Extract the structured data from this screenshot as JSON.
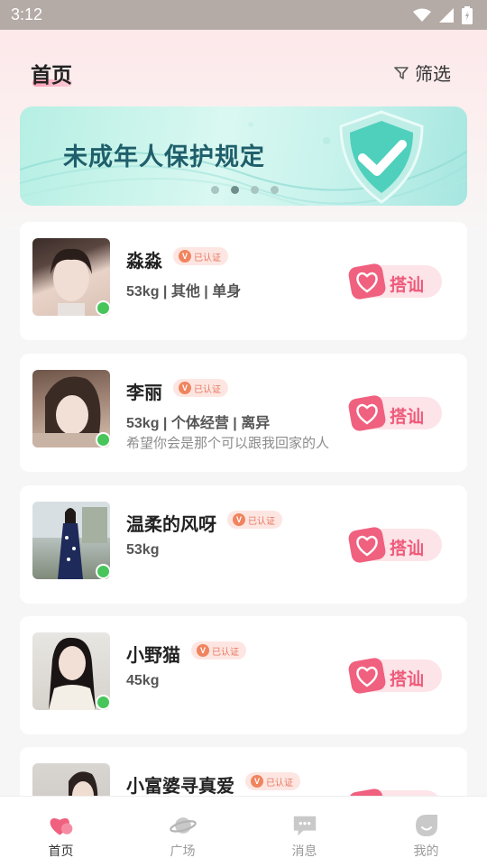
{
  "status_bar": {
    "time": "3:12"
  },
  "header": {
    "title": "首页",
    "filter_label": "筛选"
  },
  "banner": {
    "text": "未成年人保护规定",
    "active_dot": 2
  },
  "verified_label": "已认证",
  "chat_label": "搭讪",
  "users": [
    {
      "name": "淼淼",
      "info": "53kg | 其他 | 单身",
      "signature": "",
      "online": true
    },
    {
      "name": "李丽",
      "info": "53kg | 个体经营 | 离异",
      "signature": "希望你会是那个可以跟我回家的人",
      "online": true
    },
    {
      "name": "温柔的风呀",
      "info": "53kg",
      "signature": "",
      "online": true
    },
    {
      "name": "小野猫",
      "info": "45kg",
      "signature": "",
      "online": true
    },
    {
      "name": "小富婆寻真爱",
      "info": "",
      "signature": "",
      "online": false
    }
  ],
  "nav": {
    "home": "首页",
    "plaza": "广场",
    "messages": "消息",
    "mine": "我的"
  },
  "colors": {
    "accent_pink": "#ee5a7a",
    "online_green": "#47c55b",
    "verified_orange": "#f0845e",
    "banner_text": "#1f5f6b"
  }
}
